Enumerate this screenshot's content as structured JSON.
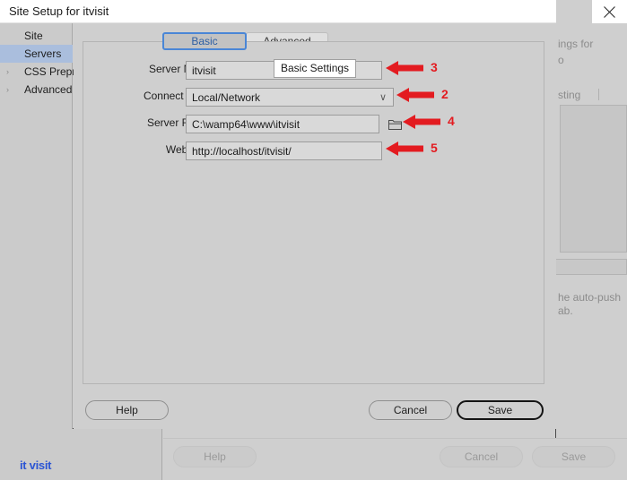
{
  "background_window": {
    "logo_text": "it visit",
    "texts": [
      "ings for",
      "o",
      "sting",
      "he auto-push",
      "ab."
    ],
    "buttons": {
      "help": "Help",
      "cancel": "Cancel",
      "save": "Save"
    }
  },
  "dialog": {
    "title": "Site Setup for itvisit",
    "close_icon": "close-icon",
    "sidebar": {
      "items": [
        {
          "label": "Site",
          "selected": false,
          "expandable": false
        },
        {
          "label": "Servers",
          "selected": true,
          "expandable": false
        },
        {
          "label": "CSS Prepro",
          "selected": false,
          "expandable": true
        },
        {
          "label": "Advanced",
          "selected": false,
          "expandable": true
        }
      ],
      "twisty_glyph": "›"
    },
    "tabs": [
      {
        "label": "Basic",
        "active": true
      },
      {
        "label": "Advanced",
        "active": false
      }
    ],
    "fields": [
      {
        "label": "Server Name:",
        "value": "itvisit",
        "type": "text"
      },
      {
        "label": "Connect using:",
        "value": "Local/Network",
        "type": "select",
        "chevron": "∨"
      },
      {
        "label": "Server Folder:",
        "value": "C:\\wamp64\\www\\itvisit",
        "type": "text-with-browse",
        "browse_icon": "folder-icon"
      },
      {
        "label": "Web URL:",
        "value": "http://localhost/itvisit/",
        "type": "text"
      }
    ],
    "tooltip": {
      "text": "Basic Settings"
    },
    "buttons": {
      "help": "Help",
      "cancel": "Cancel",
      "save": "Save"
    }
  },
  "annotations": {
    "color": "#e31b20",
    "markers": [
      {
        "number": "3",
        "target": "server-name-field"
      },
      {
        "number": "2",
        "target": "connect-using-select"
      },
      {
        "number": "4",
        "target": "server-folder-browse"
      },
      {
        "number": "5",
        "target": "web-url-field"
      }
    ]
  }
}
